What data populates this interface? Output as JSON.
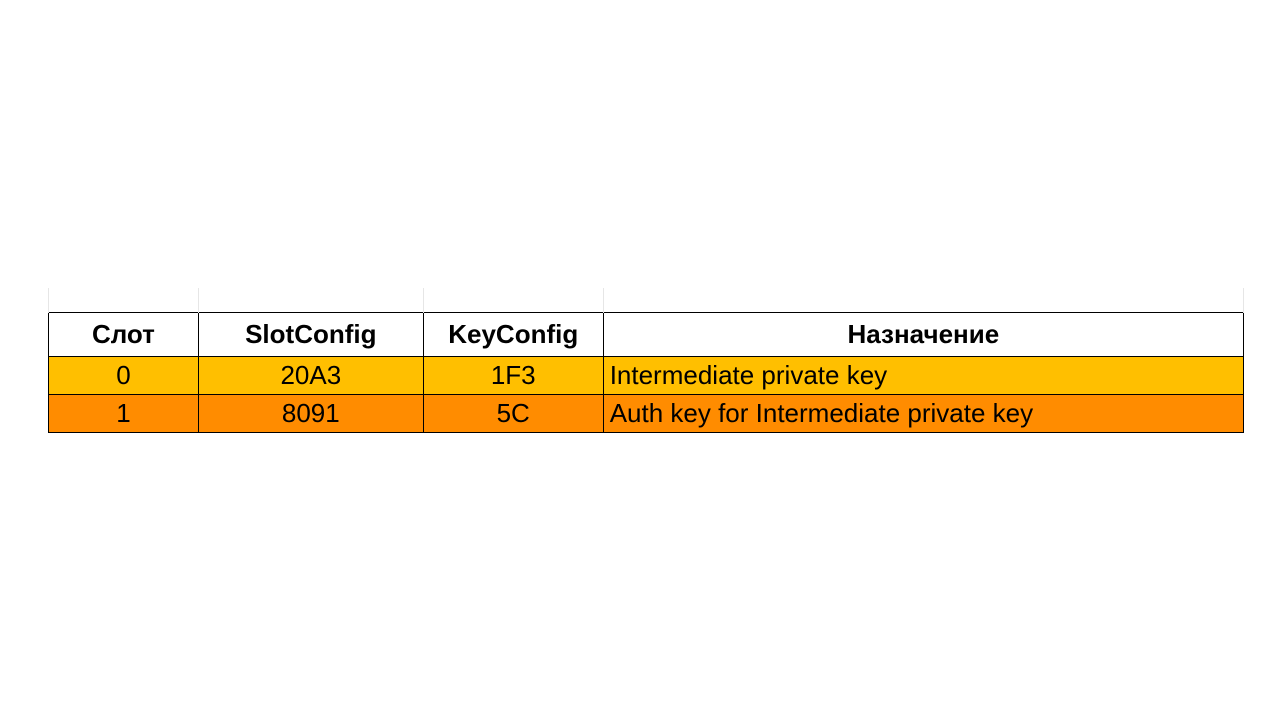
{
  "table": {
    "headers": {
      "slot": "Слот",
      "slotConfig": "SlotConfig",
      "keyConfig": "KeyConfig",
      "purpose": "Назначение"
    },
    "rows": [
      {
        "slot": "0",
        "slotConfig": "20A3",
        "keyConfig": "1F3",
        "purpose": "Intermediate private key"
      },
      {
        "slot": "1",
        "slotConfig": "8091",
        "keyConfig": "5C",
        "purpose": "Auth key for Intermediate private key"
      }
    ]
  },
  "colors": {
    "rowA": "#ffbf00",
    "rowB": "#ff8c00"
  }
}
